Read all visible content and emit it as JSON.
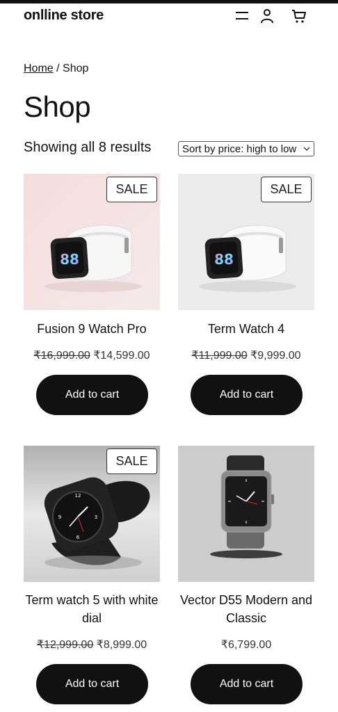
{
  "header": {
    "logo": "onlline store",
    "menu_icon": "hamburger-icon",
    "account_icon": "user-icon",
    "cart_icon": "cart-icon"
  },
  "breadcrumb": {
    "home": "Home",
    "separator": " / ",
    "current": "Shop"
  },
  "page_title": "Shop",
  "result_count": "Showing all 8 results",
  "sort": {
    "selected": "Sort by price: high to low"
  },
  "products": [
    {
      "name": "Fusion 9 Watch Pro",
      "old_price": "₹16,999.00",
      "price": "₹14,599.00",
      "badge": "SALE",
      "button": "Add to cart"
    },
    {
      "name": "Term Watch 4",
      "old_price": "₹11,999.00",
      "price": "₹9,999.00",
      "badge": "SALE",
      "button": "Add to cart"
    },
    {
      "name": "Term watch 5 with white dial",
      "old_price": "₹12,999.00",
      "price": "₹8,999.00",
      "badge": "SALE",
      "button": "Add to cart"
    },
    {
      "name": "Vector D55 Modern and Classic",
      "price": "₹6,799.00",
      "button": "Add to cart"
    }
  ]
}
